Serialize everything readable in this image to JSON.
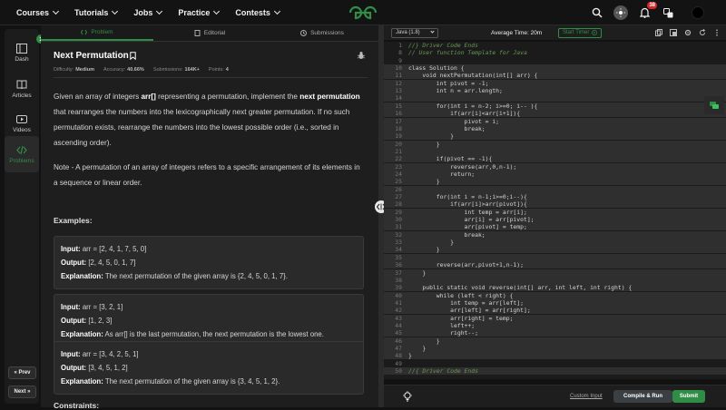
{
  "nav": {
    "items": [
      "Courses",
      "Tutorials",
      "Jobs",
      "Practice",
      "Contests"
    ],
    "notification_count": "38"
  },
  "sidebar": {
    "items": [
      {
        "label": "Dash",
        "icon": "dashboard-icon"
      },
      {
        "label": "Articles",
        "icon": "book-icon"
      },
      {
        "label": "Videos",
        "icon": "video-icon"
      },
      {
        "label": "Problems",
        "icon": "code-icon"
      }
    ],
    "prev_label": "Prev",
    "next_label": "Next"
  },
  "tabs": [
    {
      "label": "Problem",
      "active": true
    },
    {
      "label": "Editorial",
      "active": false
    },
    {
      "label": "Submissions",
      "active": false
    }
  ],
  "problem": {
    "title": "Next Permutation",
    "difficulty_label": "Difficulty:",
    "difficulty": "Medium",
    "accuracy_label": "Accuracy:",
    "accuracy": "40.66%",
    "submissions_label": "Submissions:",
    "submissions": "164K+",
    "points_label": "Points:",
    "points": "4",
    "desc1_a": "Given an array of integers ",
    "desc1_b": "arr[]",
    "desc1_c": " representing a permutation, implement the ",
    "desc1_d": "next permutation",
    "desc1_e": " that rearranges the numbers into the lexicographically next greater permutation. If no such permutation exists, rearrange the numbers into the lowest possible order (i.e., sorted in ascending order).",
    "desc2": "Note - A permutation of an array of integers refers to a specific arrangement of its elements in a sequence or linear order.",
    "examples_heading": "Examples:",
    "constraints_heading": "Constraints:",
    "examples": [
      {
        "input": "arr = [2, 4, 1, 7, 5, 0]",
        "output": "[2, 4, 5, 0, 1, 7]",
        "explanation": "The next permutation of the given array is {2, 4, 5, 0, 1, 7}."
      },
      {
        "input": "arr = [3, 2, 1]",
        "output": "[1, 2, 3]",
        "explanation": "As arr[] is the last permutation, the next permutation is the lowest one."
      },
      {
        "input": "arr = [3, 4, 2, 5, 1]",
        "output": "[3, 4, 5, 1, 2]",
        "explanation": "The next permutation of the given array is {3, 4, 5, 1, 2}."
      }
    ],
    "input_label": "Input:",
    "output_label": "Output:",
    "explanation_label": "Explanation:"
  },
  "editor": {
    "language": "Java (1.8)",
    "avg_time": "Average Time: 20m",
    "timer_label": "Start Timer",
    "custom_input": "Custom Input",
    "compile_label": "Compile & Run",
    "submit_label": "Submit",
    "lines": [
      {
        "n": "1",
        "t": "//} Driver Code Ends",
        "hl": false
      },
      {
        "n": "8",
        "t": "// User function Template for Java",
        "hl": false
      },
      {
        "n": "9",
        "t": "",
        "hl": false
      },
      {
        "n": "10",
        "t": "class Solution {",
        "hl": true
      },
      {
        "n": "11",
        "t": "    void nextPermutation(int[] arr) {",
        "hl": true
      },
      {
        "n": "12",
        "t": "        int pivot = -1;",
        "hl": true
      },
      {
        "n": "13",
        "t": "        int n = arr.length;",
        "hl": true
      },
      {
        "n": "14",
        "t": "",
        "hl": true
      },
      {
        "n": "15",
        "t": "        for(int i = n-2; i>=0; i-- ){",
        "hl": true
      },
      {
        "n": "16",
        "t": "            if(arr[i]<arr[i+1]){",
        "hl": true
      },
      {
        "n": "17",
        "t": "                pivot = i;",
        "hl": true
      },
      {
        "n": "18",
        "t": "                break;",
        "hl": true
      },
      {
        "n": "19",
        "t": "            }",
        "hl": true
      },
      {
        "n": "20",
        "t": "        }",
        "hl": true
      },
      {
        "n": "21",
        "t": "",
        "hl": true
      },
      {
        "n": "22",
        "t": "        if(pivot == -1){",
        "hl": true
      },
      {
        "n": "23",
        "t": "            reverse(arr,0,n-1);",
        "hl": true
      },
      {
        "n": "24",
        "t": "            return;",
        "hl": true
      },
      {
        "n": "25",
        "t": "        }",
        "hl": true
      },
      {
        "n": "26",
        "t": "",
        "hl": true
      },
      {
        "n": "27",
        "t": "        for(int i = n-1;i>=0;i--){",
        "hl": true
      },
      {
        "n": "28",
        "t": "            if(arr[i]>arr[pivot]){",
        "hl": true
      },
      {
        "n": "29",
        "t": "                int temp = arr[i];",
        "hl": true
      },
      {
        "n": "30",
        "t": "                arr[i] = arr[pivot];",
        "hl": true
      },
      {
        "n": "31",
        "t": "                arr[pivot] = temp;",
        "hl": true
      },
      {
        "n": "32",
        "t": "                break;",
        "hl": true
      },
      {
        "n": "33",
        "t": "            }",
        "hl": true
      },
      {
        "n": "34",
        "t": "        }",
        "hl": true
      },
      {
        "n": "35",
        "t": "",
        "hl": true
      },
      {
        "n": "36",
        "t": "        reverse(arr,pivot+1,n-1);",
        "hl": true
      },
      {
        "n": "37",
        "t": "    }",
        "hl": true
      },
      {
        "n": "38",
        "t": "",
        "hl": true
      },
      {
        "n": "39",
        "t": "    public static void reverse(int[] arr, int left, int right) {",
        "hl": true
      },
      {
        "n": "40",
        "t": "        while (left < right) {",
        "hl": true
      },
      {
        "n": "41",
        "t": "            int temp = arr[left];",
        "hl": true
      },
      {
        "n": "42",
        "t": "            arr[left] = arr[right];",
        "hl": true
      },
      {
        "n": "43",
        "t": "            arr[right] = temp;",
        "hl": true
      },
      {
        "n": "44",
        "t": "            left++;",
        "hl": true
      },
      {
        "n": "45",
        "t": "            right--;",
        "hl": true
      },
      {
        "n": "46",
        "t": "        }",
        "hl": true
      },
      {
        "n": "47",
        "t": "    }",
        "hl": true
      },
      {
        "n": "48",
        "t": "}",
        "hl": true
      },
      {
        "n": "49",
        "t": "",
        "hl": false
      },
      {
        "n": "50",
        "t": "//{ Driver Code Ends",
        "hl": true
      }
    ]
  },
  "colors": {
    "brand_green": "#2f8d46",
    "background": "#121212",
    "panel": "#1e1e1e"
  }
}
